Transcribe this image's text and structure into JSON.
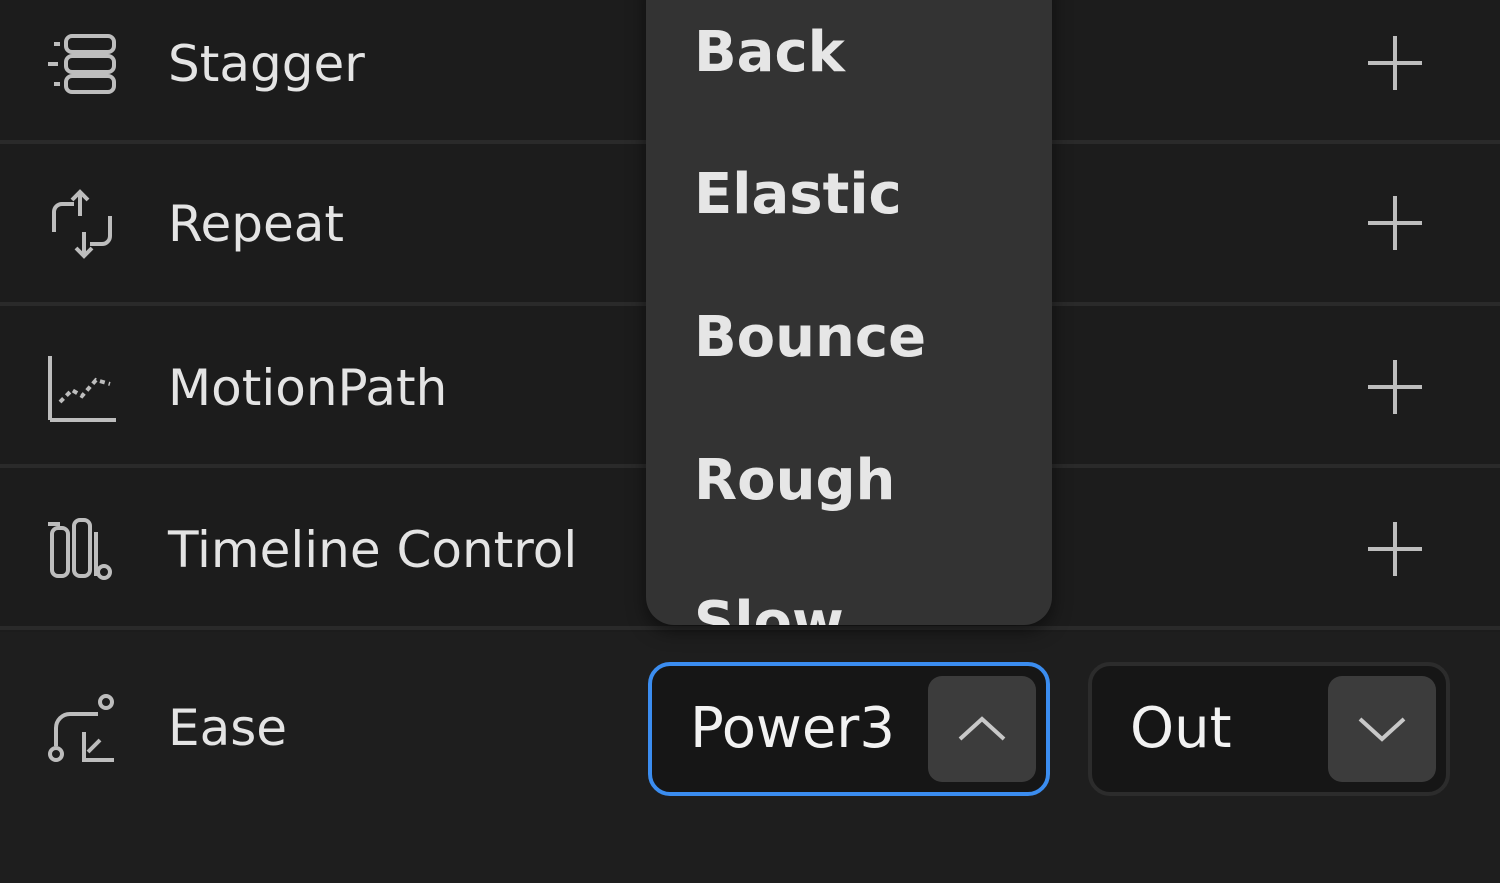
{
  "rows": [
    {
      "label": "Stagger",
      "icon": "stagger-icon"
    },
    {
      "label": "Repeat",
      "icon": "repeat-icon"
    },
    {
      "label": "MotionPath",
      "icon": "motion-path-icon"
    },
    {
      "label": "Timeline Control",
      "icon": "timeline-control-icon"
    }
  ],
  "ease": {
    "label": "Ease",
    "icon": "ease-icon",
    "type_value": "Power3",
    "direction_value": "Out"
  },
  "dropdown": {
    "options": [
      "Back",
      "Elastic",
      "Bounce",
      "Rough",
      "Slow"
    ]
  },
  "colors": {
    "background": "#1c1c1c",
    "dropdown": "#333333",
    "focus_border": "#3b8df0",
    "text": "#e6e6e6"
  }
}
